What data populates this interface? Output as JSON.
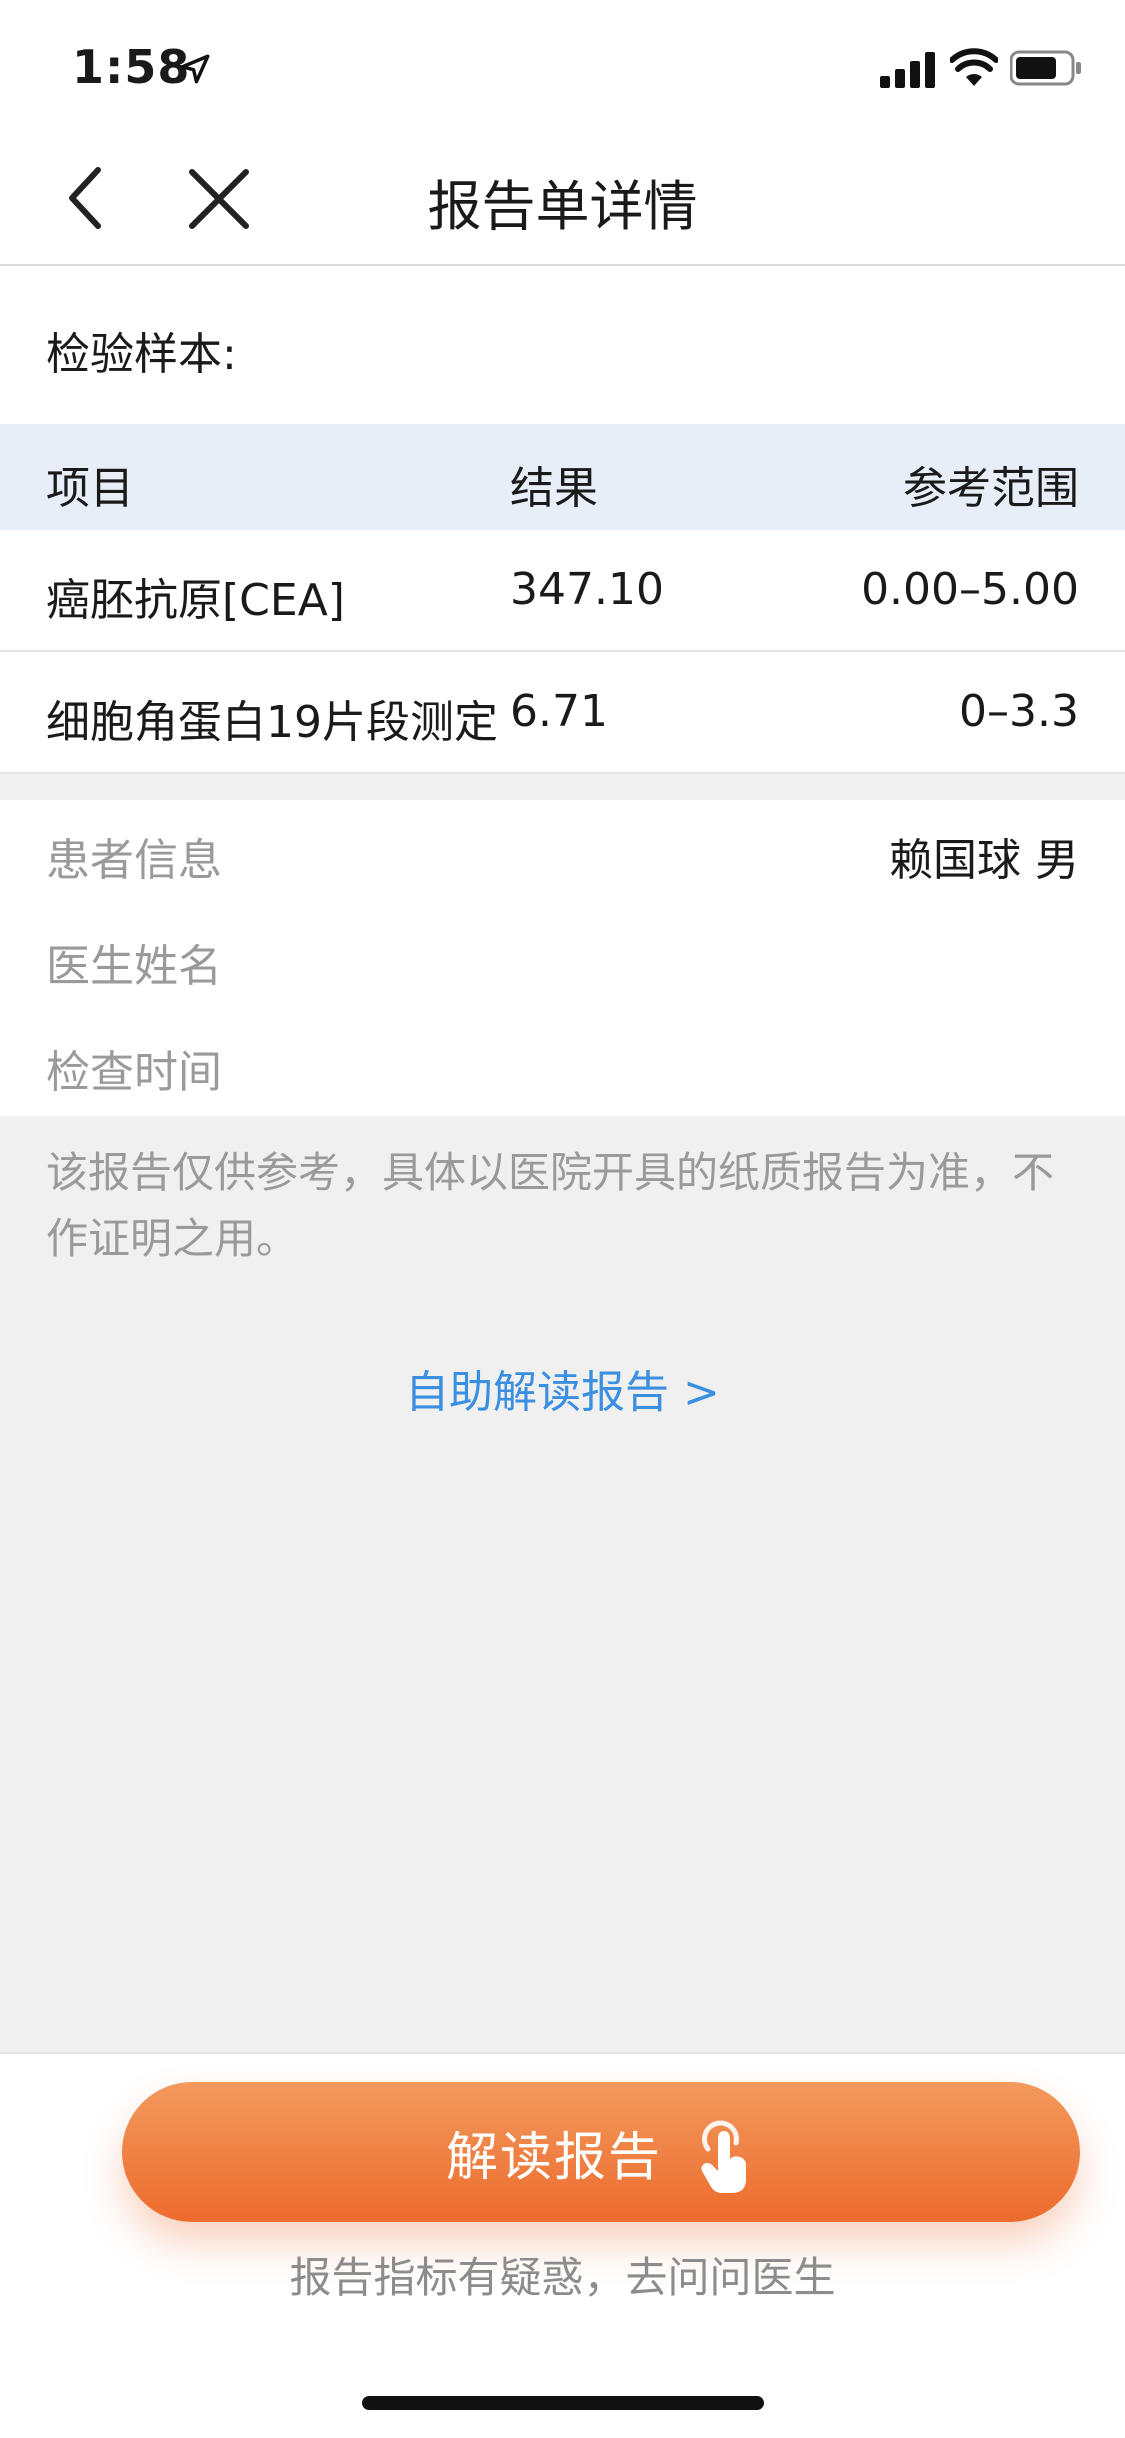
{
  "status_bar": {
    "time": "1:58"
  },
  "nav": {
    "title": "报告单详情"
  },
  "sample": {
    "label": "检验样本:"
  },
  "table": {
    "headers": [
      "项目",
      "结果",
      "参考范围"
    ],
    "rows": [
      {
        "item": "癌胚抗原[CEA]",
        "result": "347.10",
        "range": "0.00–5.00"
      },
      {
        "item": "细胞角蛋白19片段测定",
        "result": "6.71",
        "range": "0–3.3"
      }
    ]
  },
  "patient": {
    "info_label": "患者信息",
    "info_value": "赖国球   男",
    "doctor_label": "医生姓名",
    "time_label": "检查时间"
  },
  "disclaimer": "该报告仅供参考，具体以医院开具的纸质报告为准，不作证明之用。",
  "self_read_link": "自助解读报告 >",
  "cta": {
    "label": "解读报告",
    "subtitle": "报告指标有疑惑，去问问医生"
  },
  "colors": {
    "accent": "#ec6b2d",
    "link": "#3b8fe0",
    "table_header": "#e7eef8"
  }
}
